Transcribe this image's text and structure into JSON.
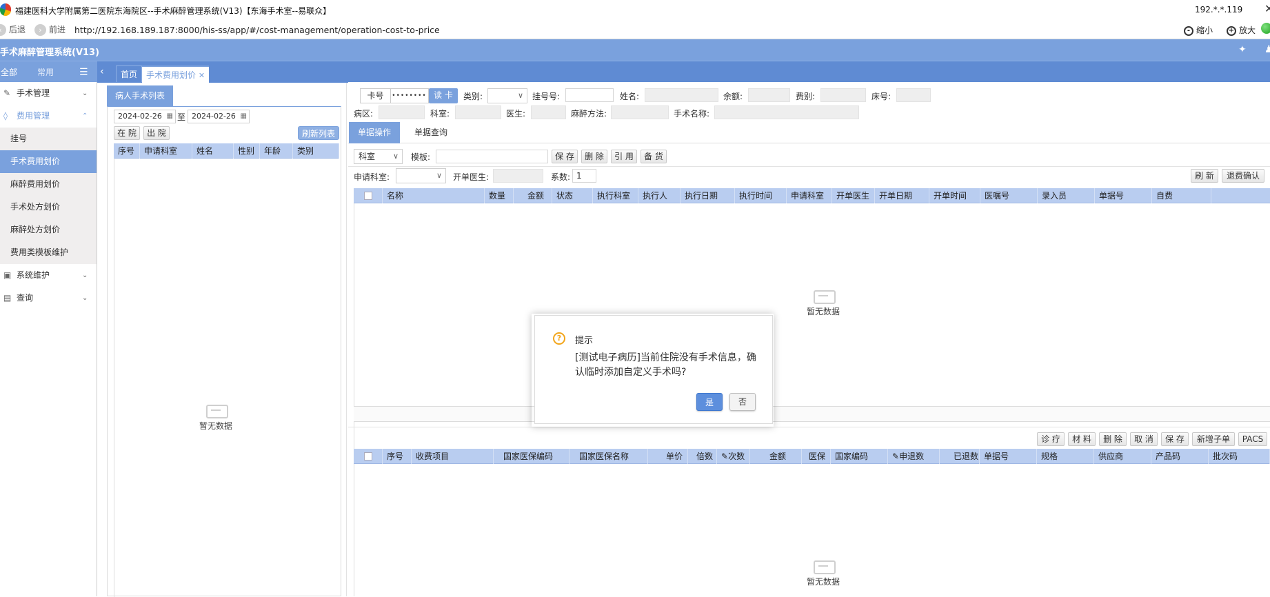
{
  "window": {
    "title": "福建医科大学附属第二医院东海院区--手术麻醉管理系统(V13)【东海手术室--易联众】",
    "ip": "192.*.*.119",
    "close_glyph": "✕"
  },
  "browser": {
    "back_label": "后退",
    "forward_label": "前进",
    "url": "http://192.168.189.187:8000/his-ss/app/#/cost-management/operation-cost-to-price",
    "zoom_out_label": "缩小",
    "zoom_in_label": "放大"
  },
  "app": {
    "title": "手术麻醉管理系统(V13)"
  },
  "sidebar": {
    "tab_all": "全部",
    "tab_common": "常用",
    "menus": [
      {
        "label": "手术管理",
        "icon": "pen-icon"
      },
      {
        "label": "费用管理",
        "icon": "coin-icon"
      },
      {
        "label": "系统维护",
        "icon": "monitor-icon"
      },
      {
        "label": "查询",
        "icon": "document-icon"
      }
    ],
    "sub_items": [
      "挂号",
      "手术费用划价",
      "麻醉费用划价",
      "手术处方划价",
      "麻醉处方划价",
      "费用类模板维护"
    ]
  },
  "tabs": {
    "home": "首页",
    "active": "手术费用划价",
    "close": "✕"
  },
  "patient_list": {
    "tab_label": "病人手术列表",
    "date_from": "2024-02-26",
    "date_sep": "至",
    "date_to": "2024-02-26",
    "in_hospital": "在 院",
    "discharged": "出 院",
    "refresh": "刷新列表",
    "columns": [
      "序号",
      "申请科室",
      "姓名",
      "性别",
      "年龄",
      "类别"
    ],
    "empty_text": "暂无数据"
  },
  "patient_info": {
    "card_label": "卡号",
    "card_value": "••••••••",
    "read_card": "读 卡",
    "category_label": "类别:",
    "reg_no_label": "挂号号:",
    "name_label": "姓名:",
    "balance_label": "余额:",
    "fee_type_label": "费别:",
    "bed_label": "床号:",
    "ward_label": "病区:",
    "dept_label": "科室:",
    "doctor_label": "医生:",
    "anesthesia_label": "麻醉方法:",
    "surgery_name_label": "手术名称:"
  },
  "bill_tabs": {
    "operate": "单据操作",
    "query": "单据查询"
  },
  "bill_toolbar": {
    "dept_select": "科室",
    "template_label": "模板:",
    "save": "保 存",
    "delete": "删 除",
    "reference": "引 用",
    "stock": "备 货",
    "apply_dept_label": "申请科室:",
    "order_doctor_label": "开单医生:",
    "coefficient_label": "系数:",
    "coefficient_value": "1",
    "refresh": "刷 新",
    "refund_confirm": "退费确认"
  },
  "bill_grid": {
    "columns": [
      "名称",
      "数量",
      "金额",
      "状态",
      "执行科室",
      "执行人",
      "执行日期",
      "执行时间",
      "申请科室",
      "开单医生",
      "开单日期",
      "开单时间",
      "医嘱号",
      "录入员",
      "单据号",
      "自费"
    ],
    "empty_text": "暂无数据"
  },
  "detail_toolbar": {
    "treatment": "诊 疗",
    "material": "材 料",
    "delete": "删 除",
    "cancel": "取 消",
    "save": "保 存",
    "new_sub": "新增子单",
    "pacs": "PACS"
  },
  "detail_grid": {
    "columns": [
      "序号",
      "收费项目",
      "国家医保编码",
      "国家医保名称",
      "单价",
      "倍数",
      "次数",
      "金额",
      "医保",
      "国家编码",
      "申退数",
      "已退数",
      "单据号",
      "规格",
      "供应商",
      "产品码",
      "批次码"
    ],
    "edit_glyph": "✎",
    "empty_text": "暂无数据"
  },
  "dialog": {
    "title": "提示",
    "message": "[测试电子病历]当前住院没有手术信息，确认临时添加自定义手术吗?",
    "yes": "是",
    "no": "否"
  }
}
